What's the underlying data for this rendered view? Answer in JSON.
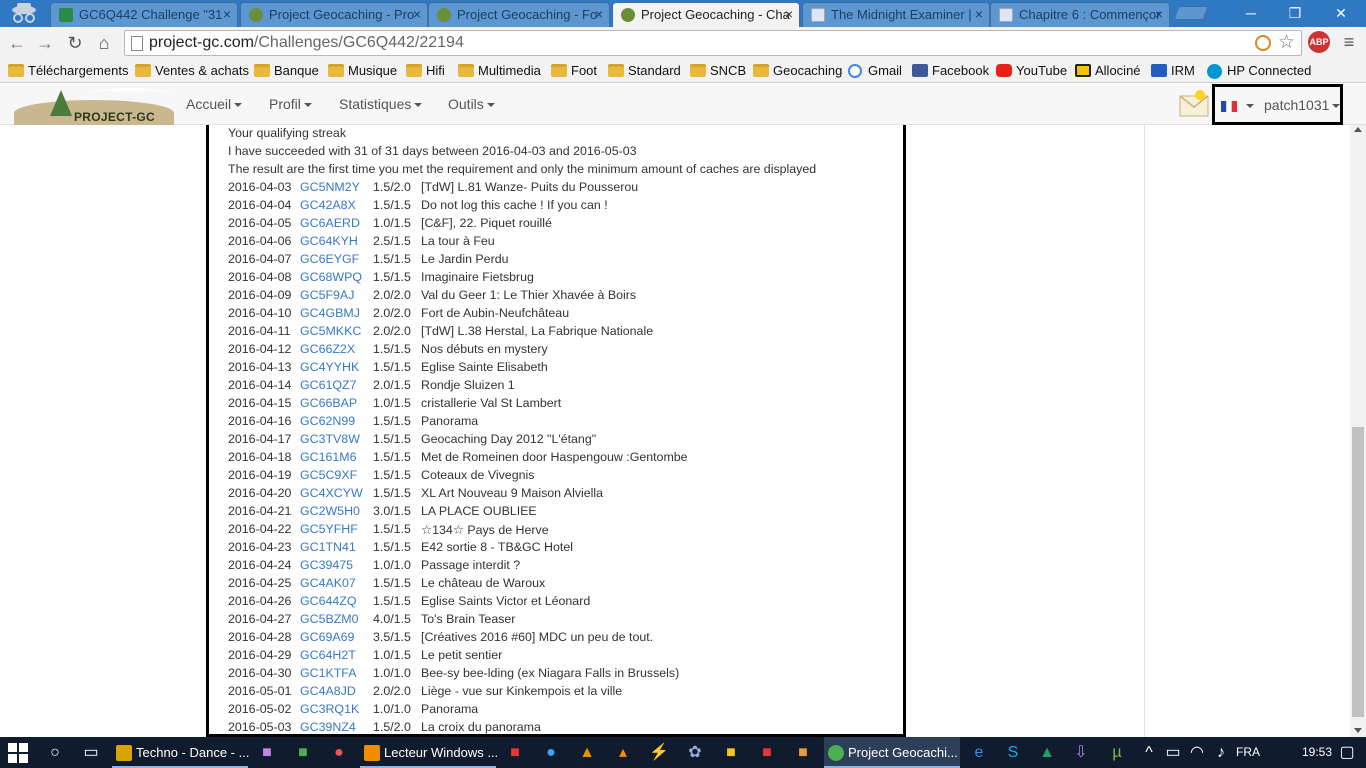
{
  "browser": {
    "tabs": [
      {
        "title": "GC6Q442 Challenge \"31",
        "color": "#2a8a4a"
      },
      {
        "title": "Project Geocaching - Pro",
        "color": "#6b8e3a"
      },
      {
        "title": "Project Geocaching - Fo",
        "color": "#6b8e3a"
      },
      {
        "title": "Project Geocaching - Cha",
        "color": "#6b8e3a"
      },
      {
        "title": "The Midnight Examiner |",
        "color": "#9aa9c4"
      },
      {
        "title": "Chapitre 6 : Commençor",
        "color": "#9aa9c4"
      }
    ],
    "url_host": "project-gc.com",
    "url_path": "/Challenges/GC6Q442/22194",
    "abp_label": "ABP",
    "window_controls": {
      "minimize": "─",
      "restore": "❐",
      "close": "✕"
    }
  },
  "bookmarks": [
    {
      "label": "Téléchargements",
      "icon": "folder"
    },
    {
      "label": "Ventes & achats",
      "icon": "folder"
    },
    {
      "label": "Banque",
      "icon": "folder"
    },
    {
      "label": "Musique",
      "icon": "folder"
    },
    {
      "label": "Hifi",
      "icon": "folder"
    },
    {
      "label": "Multimedia",
      "icon": "folder"
    },
    {
      "label": "Foot",
      "icon": "folder"
    },
    {
      "label": "Standard",
      "icon": "folder"
    },
    {
      "label": "SNCB",
      "icon": "folder"
    },
    {
      "label": "Geocaching",
      "icon": "folder"
    },
    {
      "label": "Gmail",
      "icon": "google"
    },
    {
      "label": "Facebook",
      "icon": "facebook"
    },
    {
      "label": "YouTube",
      "icon": "youtube"
    },
    {
      "label": "Allociné",
      "icon": "allocine"
    },
    {
      "label": "IRM",
      "icon": "irm"
    },
    {
      "label": "HP Connected",
      "icon": "hp"
    }
  ],
  "site": {
    "logo_text": "PROJECT-GC",
    "nav": [
      "Accueil",
      "Profil",
      "Statistiques",
      "Outils"
    ],
    "username": "patch1031"
  },
  "streak": {
    "heading": "Your qualifying streak",
    "summary": "I have succeeded with 31 of 31 days between 2016-04-03 and 2016-05-03",
    "note": "The result are the first time you met the requirement and only the minimum amount of caches are displayed",
    "rows": [
      {
        "date": "2016-04-03",
        "code": "GC5NM2Y",
        "dt": "1.5/2.0",
        "name": "[TdW] L.81 Wanze- Puits du Pousserou"
      },
      {
        "date": "2016-04-04",
        "code": "GC42A8X",
        "dt": "1.5/1.5",
        "name": "Do not log this cache ! If you can !"
      },
      {
        "date": "2016-04-05",
        "code": "GC6AERD",
        "dt": "1.0/1.5",
        "name": "[C&F], 22. Piquet rouillé"
      },
      {
        "date": "2016-04-06",
        "code": "GC64KYH",
        "dt": "2.5/1.5",
        "name": "La tour à Feu"
      },
      {
        "date": "2016-04-07",
        "code": "GC6EYGF",
        "dt": "1.5/1.5",
        "name": "Le Jardin Perdu"
      },
      {
        "date": "2016-04-08",
        "code": "GC68WPQ",
        "dt": "1.5/1.5",
        "name": "Imaginaire Fietsbrug"
      },
      {
        "date": "2016-04-09",
        "code": "GC5F9AJ",
        "dt": "2.0/2.0",
        "name": "Val du Geer 1: Le Thier Xhavée à Boirs"
      },
      {
        "date": "2016-04-10",
        "code": "GC4GBMJ",
        "dt": "2.0/2.0",
        "name": "Fort de Aubin-Neufchâteau"
      },
      {
        "date": "2016-04-11",
        "code": "GC5MKKC",
        "dt": "2.0/2.0",
        "name": "[TdW] L.38 Herstal, La Fabrique Nationale"
      },
      {
        "date": "2016-04-12",
        "code": "GC66Z2X",
        "dt": "1.5/1.5",
        "name": "Nos débuts en mystery"
      },
      {
        "date": "2016-04-13",
        "code": "GC4YYHK",
        "dt": "1.5/1.5",
        "name": "Eglise Sainte Elisabeth"
      },
      {
        "date": "2016-04-14",
        "code": "GC61QZ7",
        "dt": "2.0/1.5",
        "name": "Rondje Sluizen 1"
      },
      {
        "date": "2016-04-15",
        "code": "GC66BAP",
        "dt": "1.0/1.5",
        "name": "cristallerie Val St Lambert"
      },
      {
        "date": "2016-04-16",
        "code": "GC62N99",
        "dt": "1.5/1.5",
        "name": "Panorama"
      },
      {
        "date": "2016-04-17",
        "code": "GC3TV8W",
        "dt": "1.5/1.5",
        "name": "Geocaching Day 2012 \"L'étang\""
      },
      {
        "date": "2016-04-18",
        "code": "GC161M6",
        "dt": "1.5/1.5",
        "name": "Met de Romeinen door Haspengouw :Gentombe"
      },
      {
        "date": "2016-04-19",
        "code": "GC5C9XF",
        "dt": "1.5/1.5",
        "name": "Coteaux de Vivegnis"
      },
      {
        "date": "2016-04-20",
        "code": "GC4XCYW",
        "dt": "1.5/1.5",
        "name": "XL Art Nouveau 9 Maison Alviella"
      },
      {
        "date": "2016-04-21",
        "code": "GC2W5H0",
        "dt": "3.0/1.5",
        "name": "LA PLACE OUBLIEE"
      },
      {
        "date": "2016-04-22",
        "code": "GC5YFHF",
        "dt": "1.5/1.5",
        "name": "☆134☆ Pays de Herve"
      },
      {
        "date": "2016-04-23",
        "code": "GC1TN41",
        "dt": "1.5/1.5",
        "name": "E42 sortie 8 - TB&GC Hotel"
      },
      {
        "date": "2016-04-24",
        "code": "GC39475",
        "dt": "1.0/1.0",
        "name": "Passage interdit ?"
      },
      {
        "date": "2016-04-25",
        "code": "GC4AK07",
        "dt": "1.5/1.5",
        "name": "Le château de Waroux"
      },
      {
        "date": "2016-04-26",
        "code": "GC644ZQ",
        "dt": "1.5/1.5",
        "name": "Eglise Saints Victor et Léonard"
      },
      {
        "date": "2016-04-27",
        "code": "GC5BZM0",
        "dt": "4.0/1.5",
        "name": "To's Brain Teaser"
      },
      {
        "date": "2016-04-28",
        "code": "GC69A69",
        "dt": "3.5/1.5",
        "name": "[Créatives 2016 #60] MDC un peu de tout."
      },
      {
        "date": "2016-04-29",
        "code": "GC64H2T",
        "dt": "1.0/1.5",
        "name": "Le petit sentier"
      },
      {
        "date": "2016-04-30",
        "code": "GC1KTFA",
        "dt": "1.0/1.0",
        "name": "Bee-sy bee-lding (ex Niagara Falls in Brussels)"
      },
      {
        "date": "2016-05-01",
        "code": "GC4A8JD",
        "dt": "2.0/2.0",
        "name": "Liège - vue sur Kinkempois et la ville"
      },
      {
        "date": "2016-05-02",
        "code": "GC3RQ1K",
        "dt": "1.0/1.0",
        "name": "Panorama"
      },
      {
        "date": "2016-05-03",
        "code": "GC39NZ4",
        "dt": "1.5/2.0",
        "name": "La croix du panorama"
      }
    ]
  },
  "taskbar": {
    "apps": [
      {
        "label": "Techno - Dance - ...",
        "color": "#d9a400"
      },
      {
        "label": "Lecteur Windows ...",
        "color": "#f08c00"
      },
      {
        "label": "Project Geocachi...",
        "color": "#4caf50"
      }
    ],
    "language": "FRA",
    "time": "19:53"
  },
  "colors": {
    "link": "#3879c3",
    "tabbar": "#2f78c2",
    "taskbar": "#101c2e"
  }
}
